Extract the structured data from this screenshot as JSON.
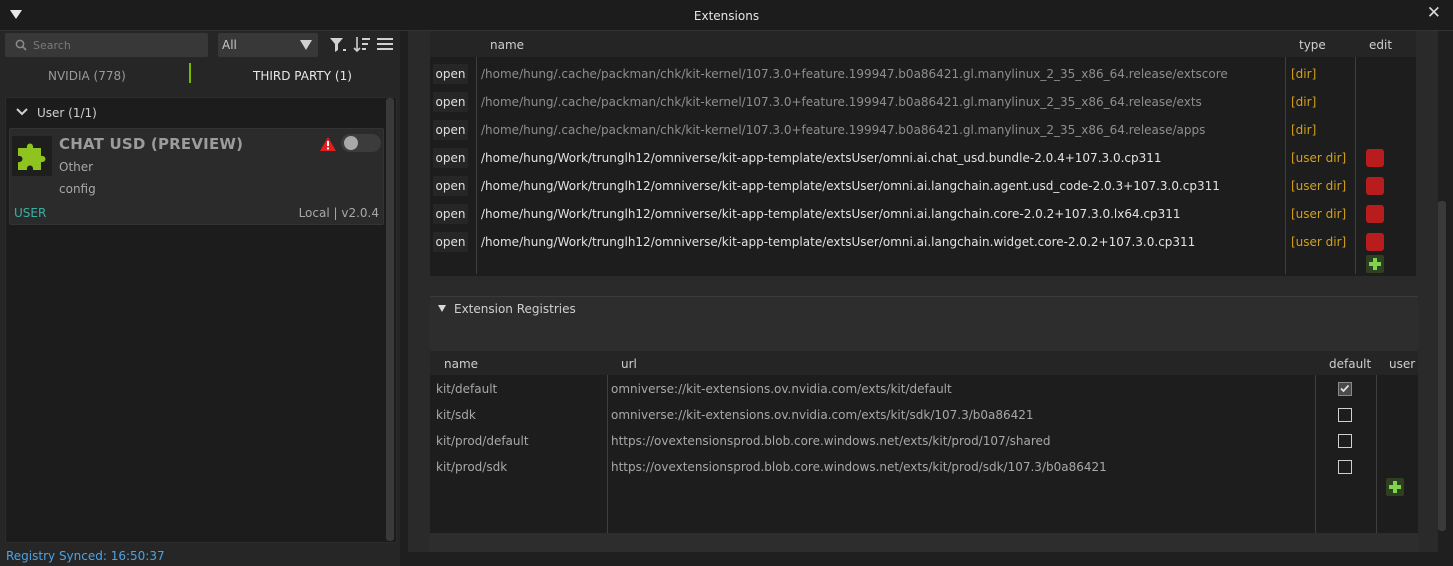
{
  "window": {
    "title": "Extensions",
    "close_glyph": "✕"
  },
  "toolbar": {
    "search_placeholder": "Search",
    "filter_value": "All"
  },
  "tabs": {
    "nvidia": "NVIDIA (778)",
    "third_party": "THIRD PARTY (1)"
  },
  "group": {
    "label": "User (1/1)"
  },
  "extension_card": {
    "name": "CHAT USD (PREVIEW)",
    "category": "Other",
    "subtitle": "config",
    "source": "USER",
    "version": "Local | v2.0.4",
    "enabled": false
  },
  "status": "Registry Synced: 16:50:37",
  "paths_table": {
    "col_name": "name",
    "col_type": "type",
    "col_edit": "edit",
    "rows": [
      {
        "action": "open",
        "path": "/home/hung/.cache/packman/chk/kit-kernel/107.3.0+feature.199947.b0a86421.gl.manylinux_2_35_x86_64.release/extscore",
        "type": "[dir]",
        "user": false
      },
      {
        "action": "open",
        "path": "/home/hung/.cache/packman/chk/kit-kernel/107.3.0+feature.199947.b0a86421.gl.manylinux_2_35_x86_64.release/exts",
        "type": "[dir]",
        "user": false
      },
      {
        "action": "open",
        "path": "/home/hung/.cache/packman/chk/kit-kernel/107.3.0+feature.199947.b0a86421.gl.manylinux_2_35_x86_64.release/apps",
        "type": "[dir]",
        "user": false
      },
      {
        "action": "open",
        "path": "/home/hung/Work/trunglh12/omniverse/kit-app-template/extsUser/omni.ai.chat_usd.bundle-2.0.4+107.3.0.cp311",
        "type": "[user dir]",
        "user": true
      },
      {
        "action": "open",
        "path": "/home/hung/Work/trunglh12/omniverse/kit-app-template/extsUser/omni.ai.langchain.agent.usd_code-2.0.3+107.3.0.cp311",
        "type": "[user dir]",
        "user": true
      },
      {
        "action": "open",
        "path": "/home/hung/Work/trunglh12/omniverse/kit-app-template/extsUser/omni.ai.langchain.core-2.0.2+107.3.0.lx64.cp311",
        "type": "[user dir]",
        "user": true
      },
      {
        "action": "open",
        "path": "/home/hung/Work/trunglh12/omniverse/kit-app-template/extsUser/omni.ai.langchain.widget.core-2.0.2+107.3.0.cp311",
        "type": "[user dir]",
        "user": true
      }
    ]
  },
  "registries": {
    "section_title": "Extension Registries",
    "col_name": "name",
    "col_url": "url",
    "col_default": "default",
    "col_user": "user",
    "rows": [
      {
        "name": "kit/default",
        "url": "omniverse://kit-extensions.ov.nvidia.com/exts/kit/default",
        "default": true
      },
      {
        "name": "kit/sdk",
        "url": "omniverse://kit-extensions.ov.nvidia.com/exts/kit/sdk/107.3/b0a86421",
        "default": false
      },
      {
        "name": "kit/prod/default",
        "url": "https://ovextensionsprod.blob.core.windows.net/exts/kit/prod/107/shared",
        "default": false
      },
      {
        "name": "kit/prod/sdk",
        "url": "https://ovextensionsprod.blob.core.windows.net/exts/kit/prod/sdk/107.3/b0a86421",
        "default": false
      }
    ]
  },
  "colors": {
    "accent_green": "#76b900",
    "type_yellow": "#d4a017",
    "delete_red": "#b81c1c",
    "status_blue": "#4aa3e6",
    "user_teal": "#3cb0a0"
  }
}
